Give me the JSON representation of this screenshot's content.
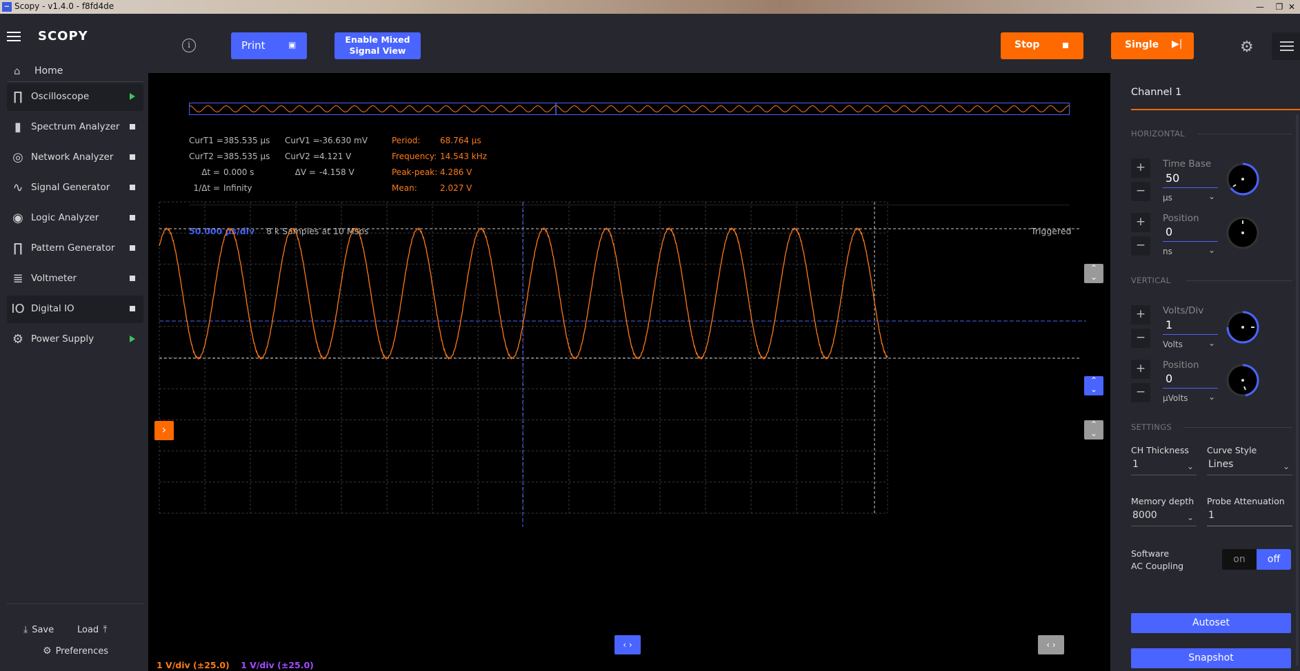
{
  "window": {
    "title": "Scopy - v1.4.0 - f8fd4de",
    "minimize": "—",
    "maximize": "❐",
    "close": "✕"
  },
  "sidebar": {
    "logo": "SCOPY",
    "home": "Home",
    "tools": [
      {
        "label": "Oscilloscope",
        "state": "running",
        "icon": "oscilloscope-icon",
        "glyph": "∏"
      },
      {
        "label": "Spectrum Analyzer",
        "state": "stopped",
        "icon": "spectrum-icon",
        "glyph": "▮"
      },
      {
        "label": "Network Analyzer",
        "state": "stopped",
        "icon": "network-icon",
        "glyph": "◎"
      },
      {
        "label": "Signal Generator",
        "state": "stopped",
        "icon": "signal-generator-icon",
        "glyph": "∿"
      },
      {
        "label": "Logic Analyzer",
        "state": "stopped",
        "icon": "logic-analyzer-icon",
        "glyph": "◉"
      },
      {
        "label": "Pattern Generator",
        "state": "stopped",
        "icon": "pattern-generator-icon",
        "glyph": "∏"
      },
      {
        "label": "Voltmeter",
        "state": "stopped",
        "icon": "voltmeter-icon",
        "glyph": "≣"
      },
      {
        "label": "Digital IO",
        "state": "stopped",
        "icon": "digital-io-icon",
        "glyph": "IO"
      },
      {
        "label": "Power Supply",
        "state": "running",
        "icon": "power-supply-icon",
        "glyph": "⚙"
      }
    ],
    "save": "Save",
    "load": "Load",
    "preferences": "Preferences"
  },
  "toolbar": {
    "print": "Print",
    "mixed_line1": "Enable Mixed",
    "mixed_line2": "Signal View",
    "stop": "Stop",
    "single": "Single"
  },
  "measurements": {
    "cursors": [
      {
        "label": "CurT1 =",
        "value": "385.535 μs"
      },
      {
        "label": "CurT2 =",
        "value": "385.535 μs"
      },
      {
        "label": "Δt =",
        "value": "0.000 s"
      },
      {
        "label": "1/Δt =",
        "value": "Infinity"
      }
    ],
    "cursors_v": [
      {
        "label": "CurV1 =",
        "value": "-36.630 mV"
      },
      {
        "label": "CurV2 =",
        "value": "4.121 V"
      },
      {
        "label": "ΔV =",
        "value": "-4.158 V"
      }
    ],
    "stats": [
      {
        "label": "Period:",
        "value": "68.764 μs"
      },
      {
        "label": "Frequency:",
        "value": "14.543 kHz"
      },
      {
        "label": "Peak-peak:",
        "value": "4.286 V"
      },
      {
        "label": "Mean:",
        "value": "2.027 V"
      }
    ]
  },
  "plot_status": {
    "timebase": "50.000 μs/div",
    "samples": "8 k Samples at 10 Msps",
    "trigger": "Triggered",
    "ch1_scale": "1 V/div (±25.0)",
    "ch2_scale": "1 V/div (±25.0)"
  },
  "colors": {
    "accent_blue": "#4a64ff",
    "channel1": "#ff7a1a",
    "channel2": "#a04cff",
    "running": "#3dc45a"
  },
  "panel": {
    "channel": "Channel 1",
    "horizontal": "HORIZONTAL",
    "vertical": "VERTICAL",
    "settings": "SETTINGS",
    "timebase_label": "Time Base",
    "timebase_value": "50",
    "timebase_unit": "μs",
    "hpos_label": "Position",
    "hpos_value": "0",
    "hpos_unit": "ns",
    "vdiv_label": "Volts/Div",
    "vdiv_value": "1",
    "vdiv_unit": "Volts",
    "vpos_label": "Position",
    "vpos_value": "0",
    "vpos_unit": "μVolts",
    "ch_thickness_label": "CH Thickness",
    "ch_thickness_value": "1",
    "curve_style_label": "Curve Style",
    "curve_style_value": "Lines",
    "memory_depth_label": "Memory depth",
    "memory_depth_value": "8000",
    "probe_att_label": "Probe Attenuation",
    "probe_att_value": "1",
    "ac_coupling_line1": "Software",
    "ac_coupling_line2": "AC Coupling",
    "toggle_on": "on",
    "toggle_off": "off",
    "autoset": "Autoset",
    "snapshot": "Snapshot"
  },
  "signal": {
    "cycles_on_screen": 11.6,
    "high_v": 4.121,
    "low_v": -0.04
  }
}
